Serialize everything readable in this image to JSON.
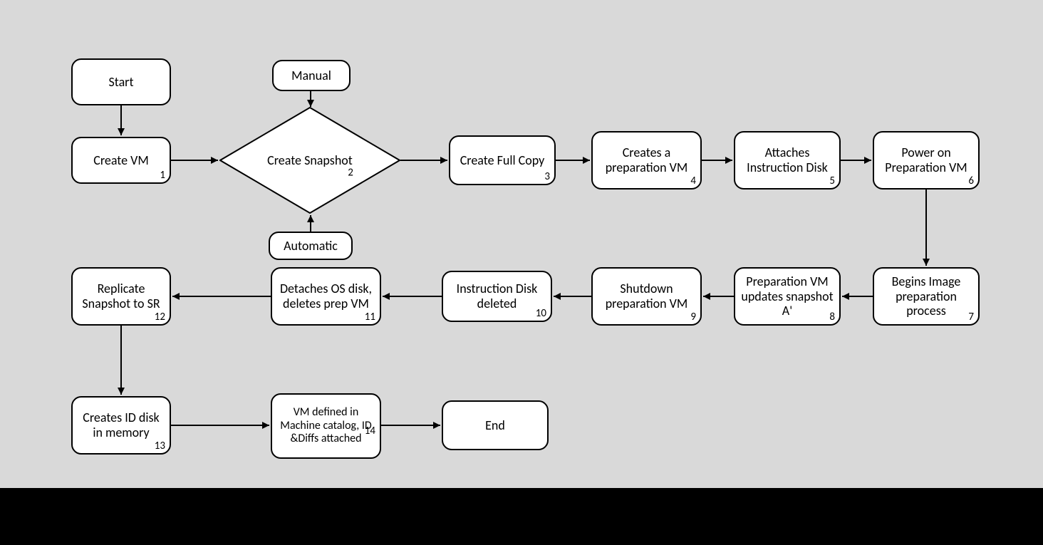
{
  "nodes": {
    "start": {
      "label": "Start"
    },
    "manual": {
      "label": "Manual"
    },
    "automatic": {
      "label": "Automatic"
    },
    "n1": {
      "label": "Create VM",
      "num": "1"
    },
    "n2": {
      "label": "Create Snapshot",
      "num": "2"
    },
    "n3": {
      "label": "Create Full Copy",
      "num": "3"
    },
    "n4": {
      "label": "Creates a preparation VM",
      "num": "4"
    },
    "n5": {
      "label": "Attaches Instruction Disk",
      "num": "5"
    },
    "n6": {
      "label": "Power on Preparation VM",
      "num": "6"
    },
    "n7": {
      "label": "Begins Image preparation process",
      "num": "7"
    },
    "n8": {
      "label": "Preparation VM updates snapshot A'",
      "num": "8"
    },
    "n9": {
      "label": "Shutdown preparation VM",
      "num": "9"
    },
    "n10": {
      "label": "Instruction Disk deleted",
      "num": "10"
    },
    "n11": {
      "label": "Detaches OS disk, deletes prep VM",
      "num": "11"
    },
    "n12": {
      "label": "Replicate Snapshot to SR",
      "num": "12"
    },
    "n13": {
      "label": "Creates ID disk in memory",
      "num": "13"
    },
    "n14": {
      "label": "VM defined in Machine catalog, ID &Diffs attached",
      "num": "14"
    },
    "end": {
      "label": "End"
    }
  }
}
